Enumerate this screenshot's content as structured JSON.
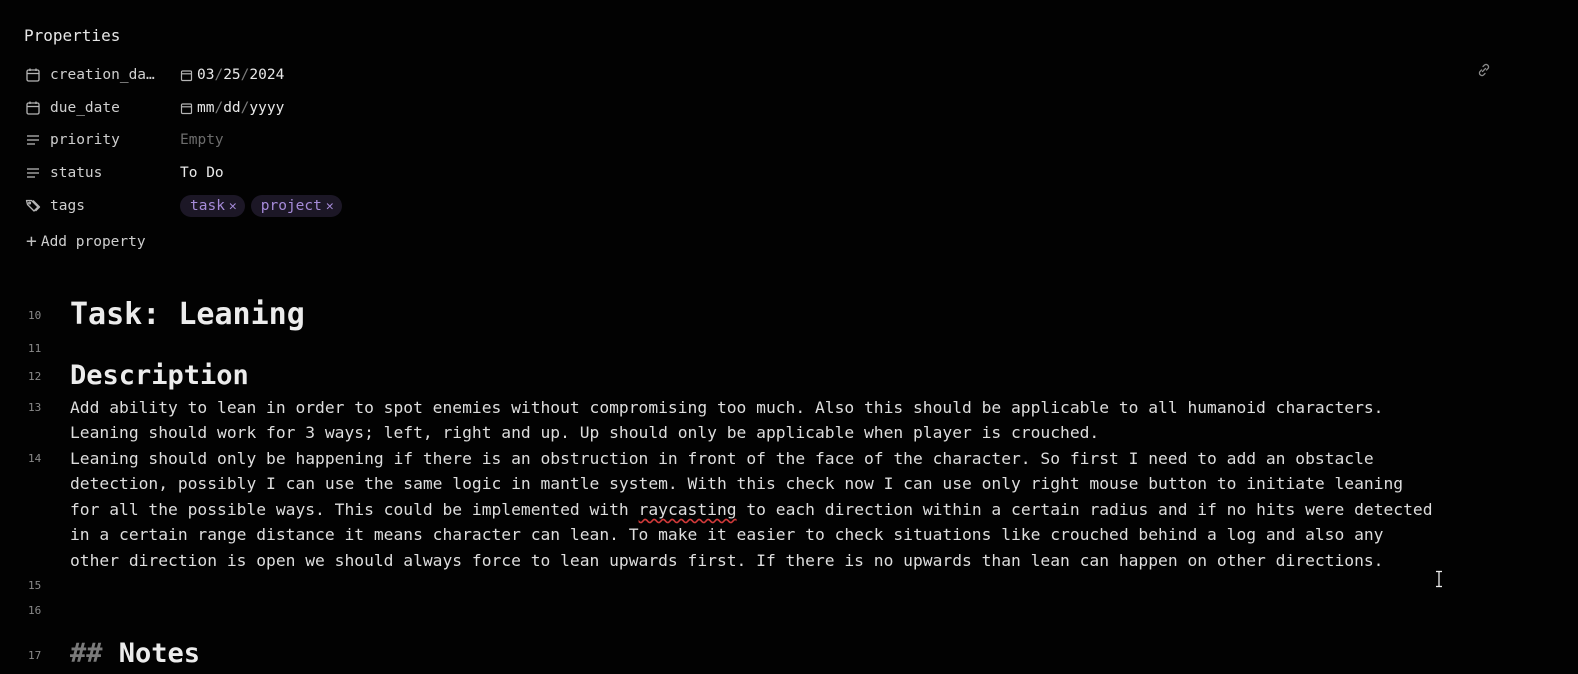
{
  "properties": {
    "header": "Properties",
    "rows": [
      {
        "key": "creation_da…",
        "icon": "calendar-icon",
        "type": "date",
        "value": [
          "03",
          "25",
          "2024"
        ]
      },
      {
        "key": "due_date",
        "icon": "calendar-icon",
        "type": "date",
        "value": [
          "mm",
          "dd",
          "yyyy"
        ]
      },
      {
        "key": "priority",
        "icon": "text-lines-icon",
        "type": "text",
        "value": "Empty"
      },
      {
        "key": "status",
        "icon": "text-lines-icon",
        "type": "text",
        "value": "To Do"
      },
      {
        "key": "tags",
        "icon": "tags-icon",
        "type": "tags",
        "value": [
          "task",
          "project"
        ]
      }
    ],
    "date_separator": "/",
    "add_property": "Add property"
  },
  "editor": {
    "line_numbers": [
      "10",
      "11",
      "12",
      "13",
      "14",
      "15",
      "16",
      "17"
    ],
    "title": "Task: Leaning",
    "description_heading": "Description",
    "para13_lines": [
      "Add ability to lean in order to spot enemies without compromising too much. Also this should be applicable to all humanoid characters.",
      "Leaning should work for 3 ways; left, right and up. Up should only be applicable when player is crouched."
    ],
    "para14_lines": [
      "Leaning should only be happening if there is an obstruction in front of the face of the character. So first I need to add an obstacle",
      "detection, possibly I can use the same logic in mantle system. With this check now I can use only right mouse button to initiate leaning",
      "in a certain range distance it means character can lean. To make it easier to check situations like crouched behind a log and also any",
      "other direction is open we should always force to lean upwards first. If there is no upwards than lean can happen on other directions."
    ],
    "para14_line3_before": "for all the possible ways. This could be implemented with ",
    "para14_line3_spell": "raycasting",
    "para14_line3_after": " to each direction within a certain radius and if no hits were detected",
    "notes_hashes": "##",
    "notes_heading": "Notes"
  }
}
